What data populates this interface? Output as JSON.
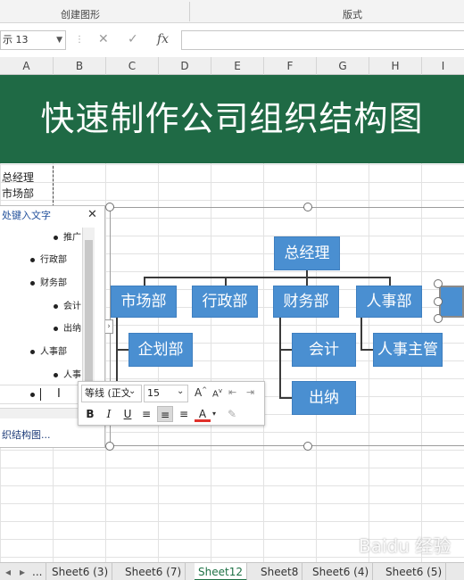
{
  "ribbon": {
    "group_left": "创建图形",
    "group_right": "版式"
  },
  "formula_bar": {
    "name_box": "示 13",
    "fx_label": "fx",
    "value": ""
  },
  "columns": [
    "A",
    "B",
    "C",
    "D",
    "E",
    "F",
    "G",
    "H",
    "I"
  ],
  "banner": {
    "title": "快速制作公司组织结构图"
  },
  "cells": {
    "a_row1": "总经理",
    "a_row2": "市场部"
  },
  "text_pane": {
    "title": "处键入文字",
    "close_icon": "close-icon",
    "items": [
      "推广",
      "行政部",
      "财务部",
      "会计",
      "出纳",
      "人事部",
      "人事"
    ],
    "link": "织结构图..."
  },
  "org_chart": {
    "root": "总经理",
    "level1": [
      "市场部",
      "行政部",
      "财务部",
      "人事部"
    ],
    "market_children": [
      "企划部"
    ],
    "finance_children": [
      "会计",
      "出纳"
    ],
    "hr_children": [
      "人事主管"
    ]
  },
  "mini_toolbar": {
    "font_name": "等线 (正文",
    "font_size": "15",
    "grow_label": "A",
    "shrink_label": "A",
    "bold": "B",
    "italic": "I",
    "underline": "U",
    "font_color_label": "A",
    "accent_color": "#e0302a"
  },
  "sheet_tabs": {
    "nav": "...",
    "tabs": [
      "Sheet6 (3)",
      "Sheet6 (7)",
      "Sheet12",
      "Sheet8",
      "Sheet6 (4)",
      "Sheet6 (5)"
    ],
    "active_index": 2
  },
  "watermark": "Baidu 经验",
  "colors": {
    "banner_bg": "#1f6a45",
    "node_fill": "#4a8fd1",
    "active_tab": "#1e7145"
  }
}
